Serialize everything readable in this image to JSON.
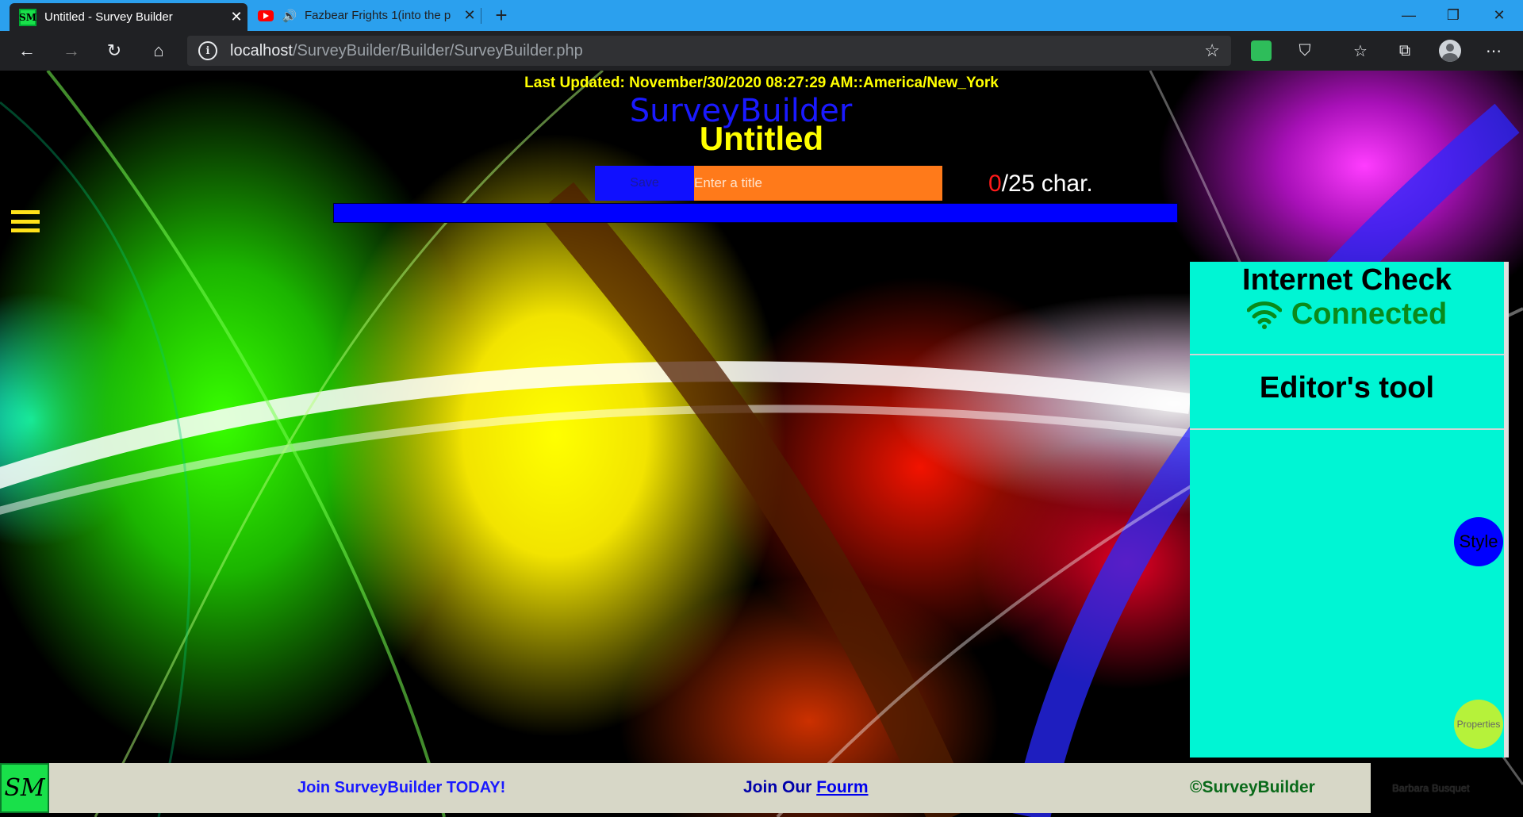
{
  "browser": {
    "tabs": [
      {
        "title": "Untitled - Survey Builder",
        "active": true,
        "favicon": "survey-builder-logo"
      },
      {
        "title": "Fazbear Frights 1(into the p",
        "active": false,
        "favicon": "youtube-icon",
        "audio": true
      }
    ],
    "url_host": "localhost",
    "url_path": "/SurveyBuilder/Builder/SurveyBuilder.php",
    "tab_bar_color": "#2ba0ee",
    "toolbar_color": "#202124"
  },
  "page": {
    "last_updated": "Last Updated: November/30/2020 08:27:29 AM::America/New_York",
    "brand": "SurveyBuilder",
    "survey_title": "Untitled",
    "save_label": "Save",
    "title_placeholder": "Enter a title",
    "char_count_current": "0",
    "char_count_rest": "/25 char.",
    "progress": 1.0,
    "accent_blue": "#0000ff",
    "accent_yellow": "#ffff00"
  },
  "panel": {
    "internet_heading": "Internet Check",
    "connection_status": "Connected",
    "editor_heading": "Editor's tool",
    "style_label": "Style",
    "properties_label": "Properties",
    "background": "#00f5d4"
  },
  "footer": {
    "logo_text": "SM",
    "join_text": "Join SurveyBuilder TODAY!",
    "forum_prefix": "Join Our ",
    "forum_link": "Fourm",
    "copyright": "©SurveyBuilder"
  },
  "credit": "Barbara Busquet"
}
